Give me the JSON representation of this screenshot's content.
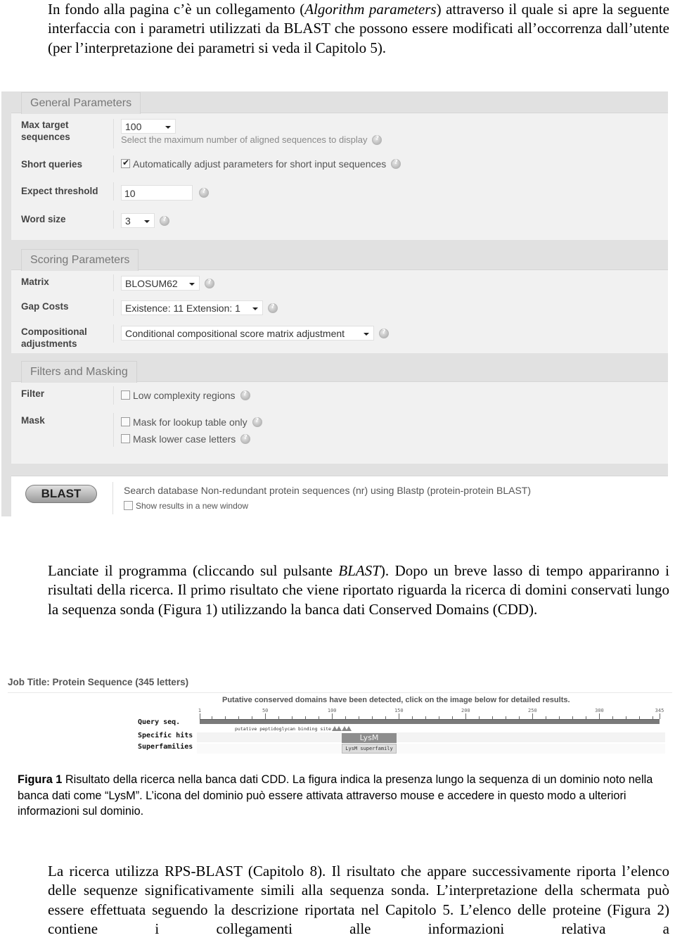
{
  "intro_paragraph": {
    "part1": "In fondo alla pagina c’è un collegamento (",
    "link_italic": "Algorithm parameters",
    "part2": ") attraverso il quale si apre la seguente interfaccia con i parametri utilizzati da BLAST che possono essere modificati all’occorrenza dall’utente (per l’interpretazione dei parametri si veda il Capitolo 5)."
  },
  "blast_form": {
    "general": {
      "title": "General Parameters",
      "max_target": {
        "label_line1": "Max target",
        "label_line2": "sequences",
        "value": "100",
        "hint": "Select the maximum number of aligned sequences to display"
      },
      "short_queries": {
        "label": "Short queries",
        "checked": true,
        "text": "Automatically adjust parameters for short input sequences"
      },
      "expect": {
        "label": "Expect threshold",
        "value": "10"
      },
      "word_size": {
        "label": "Word size",
        "value": "3"
      }
    },
    "scoring": {
      "title": "Scoring Parameters",
      "matrix": {
        "label": "Matrix",
        "value": "BLOSUM62"
      },
      "gap_costs": {
        "label": "Gap Costs",
        "value": "Existence: 11 Extension: 1"
      },
      "compositional": {
        "label_line1": "Compositional",
        "label_line2": "adjustments",
        "value": "Conditional compositional score matrix adjustment"
      }
    },
    "filters": {
      "title": "Filters and Masking",
      "filter": {
        "label": "Filter",
        "option": "Low complexity regions",
        "checked": false
      },
      "mask": {
        "label": "Mask",
        "options": [
          {
            "text": "Mask for lookup table only",
            "checked": false
          },
          {
            "text": "Mask lower case letters",
            "checked": false
          }
        ]
      }
    },
    "submit": {
      "button": "BLAST",
      "search_text": "Search database Non-redundant protein sequences (nr) using Blastp (protein-protein BLAST)",
      "new_window": "Show results in a new window",
      "new_window_checked": false
    }
  },
  "middle_paragraph": {
    "part1": "Lanciate il programma (cliccando sul pulsante ",
    "italic": "BLAST",
    "part2": "). Dopo un breve lasso di tempo appariranno i risultati della ricerca. Il primo risultato che viene riportato riguarda la ricerca di domini conservati lungo la sequenza sonda (Figura 1) utilizzando la banca dati Conserved Domains (CDD)."
  },
  "cdd_figure": {
    "job_title": "Job Title: Protein Sequence (345 letters)",
    "note": "Putative conserved domains have been detected, click on the image below for detailed results.",
    "rows": [
      "Query seq.",
      "Specific hits",
      "Superfamilies"
    ],
    "ruler_ticks": [
      "1",
      "50",
      "100",
      "150",
      "200",
      "250",
      "300",
      "345"
    ],
    "sequence_length": 345,
    "site_label": "putative peptidoglycan binding site",
    "specific_hit": "LysM",
    "superfamily": "LysM superfamily"
  },
  "caption": {
    "bold": "Figura 1",
    "text": " Risultato della ricerca nella banca dati CDD. La figura indica la presenza lungo la sequenza di un dominio noto nella banca dati come “LysM”. L’icona del dominio può essere attivata attraverso mouse e accedere in questo modo a ulteriori informazioni sul dominio."
  },
  "final_paragraph": "La ricerca utilizza RPS-BLAST (Capitolo 8). Il risultato che appare successivamente riporta l’elenco delle sequenze significativamente simili alla sequenza sonda. L’interpretazione della schermata può essere effettuata seguendo la descrizione riportata nel Capitolo 5. L’elenco delle proteine (Figura 2) contiene i collegamenti alle informazioni relativa a"
}
